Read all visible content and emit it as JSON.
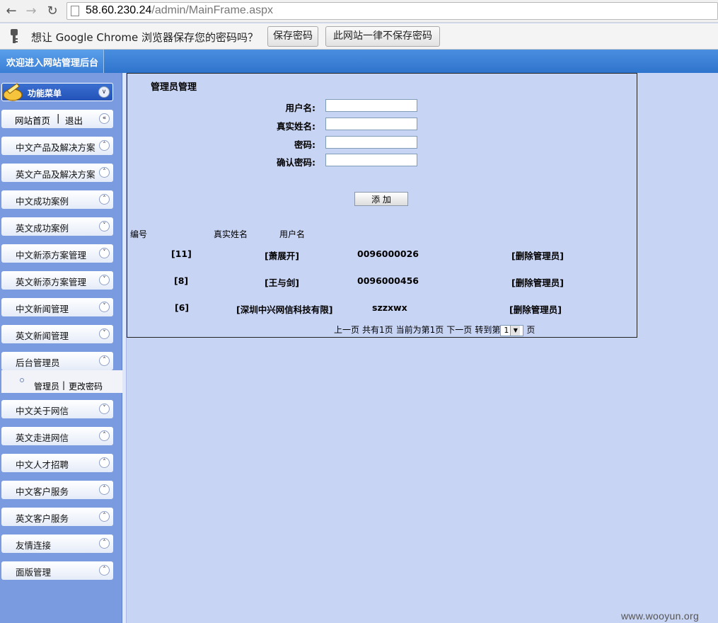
{
  "browser": {
    "url_host": "58.60.230.24",
    "url_path": "/admin/MainFrame.aspx",
    "password_prompt": "想让 Google Chrome 浏览器保存您的密码吗？",
    "save_password_label": "保存密码",
    "never_save_label": "此网站一律不保存密码"
  },
  "header": {
    "title": "欢迎进入网站管理后台"
  },
  "sidebar": {
    "menu_title": "功能菜单",
    "home_label": "网站首页",
    "separator": "|",
    "logout_label": "退出",
    "items": [
      {
        "label": "中文产品及解决方案"
      },
      {
        "label": "英文产品及解决方案"
      },
      {
        "label": "中文成功案例"
      },
      {
        "label": "英文成功案例"
      },
      {
        "label": "中文新添方案管理"
      },
      {
        "label": "英文新添方案管理"
      },
      {
        "label": "中文新闻管理"
      },
      {
        "label": "英文新闻管理"
      },
      {
        "label": "后台管理员"
      },
      {
        "label": "中文关于网信"
      },
      {
        "label": "英文走进网信"
      },
      {
        "label": "中文人才招聘"
      },
      {
        "label": "中文客户服务"
      },
      {
        "label": "英文客户服务"
      },
      {
        "label": "友情连接"
      },
      {
        "label": "面版管理"
      }
    ],
    "sub_admin_label": "管理员",
    "sub_separator": "|",
    "sub_change_pw_label": "更改密码"
  },
  "form": {
    "title": "管理员管理",
    "username_label": "用户名:",
    "realname_label": "真实姓名:",
    "password_label": "密码:",
    "confirm_label": "确认密码:",
    "username_value": "",
    "realname_value": "",
    "password_value": "",
    "confirm_value": "",
    "add_label": "添 加"
  },
  "table": {
    "headers": [
      "编号",
      "真实姓名",
      "用户名"
    ],
    "rows": [
      {
        "id": "[11]",
        "realname": "[萧展开]",
        "username": "0096000026",
        "action": "[删除管理员]"
      },
      {
        "id": "[8]",
        "realname": "[王与剑]",
        "username": "0096000456",
        "action": "[删除管理员]"
      },
      {
        "id": "[6]",
        "realname": "[深圳中兴网信科技有限]",
        "username": "szzxwx",
        "action": "[删除管理员]"
      }
    ]
  },
  "pager": {
    "prev": "上一页",
    "total": "共有1页",
    "current": "当前为第1页",
    "next": "下一页",
    "goto": "转到第",
    "selected_page": "1",
    "page_unit": "页"
  },
  "watermark": "www.wooyun.org"
}
